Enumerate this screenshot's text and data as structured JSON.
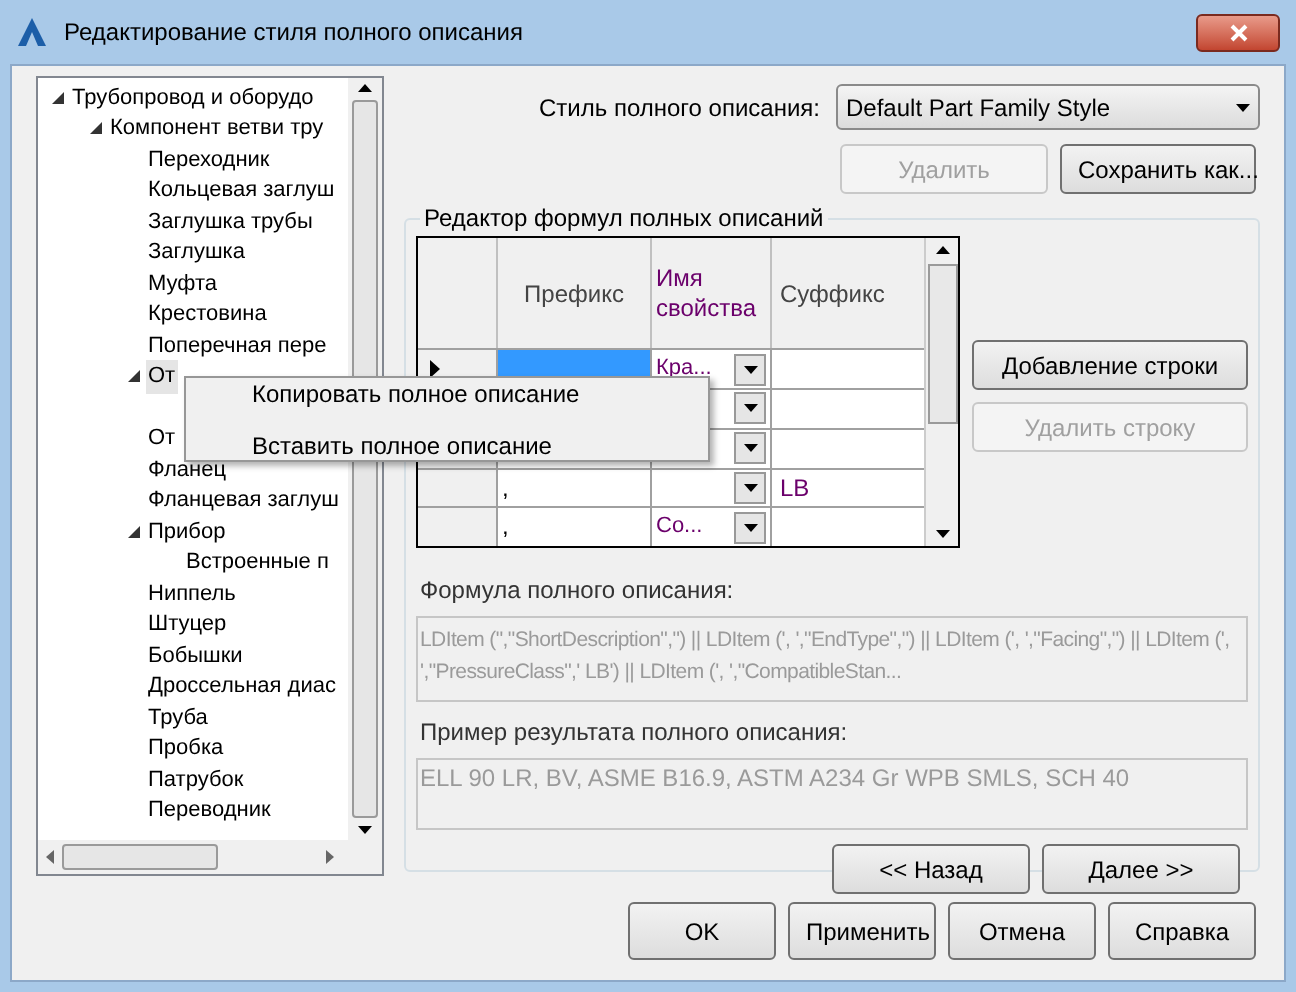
{
  "window": {
    "title": "Редактирование стиля полного описания"
  },
  "tree": [
    {
      "label": "Трубопровод и оборудо",
      "expanded": true,
      "children": [
        {
          "label": "Компонент ветви тру",
          "expanded": true,
          "children": [
            {
              "label": "Переходник"
            },
            {
              "label": "Кольцевая заглуш"
            },
            {
              "label": "Заглушка трубы"
            },
            {
              "label": "Заглушка"
            },
            {
              "label": "Муфта"
            },
            {
              "label": "Крестовина"
            },
            {
              "label": "Поперечная пере"
            },
            {
              "label": "От",
              "expanded": true,
              "selected": true
            },
            {
              "label": "От"
            },
            {
              "label": "Фланец"
            },
            {
              "label": "Фланцевая заглуш"
            },
            {
              "label": "Прибор",
              "expanded": true,
              "children": [
                {
                  "label": "Встроенные п"
                }
              ]
            },
            {
              "label": "Ниппель"
            },
            {
              "label": "Штуцер"
            },
            {
              "label": "Бобышки"
            },
            {
              "label": "Дроссельная диас"
            },
            {
              "label": "Труба"
            },
            {
              "label": "Пробка"
            },
            {
              "label": "Патрубок"
            },
            {
              "label": "Переводник"
            }
          ]
        }
      ]
    }
  ],
  "style": {
    "label": "Стиль полного описания:",
    "value": "Default Part Family Style"
  },
  "style_buttons": [
    {
      "label": "Удалить",
      "disabled": true
    },
    {
      "label": "Сохранить как...",
      "disabled": false
    }
  ],
  "editor": {
    "title": "Редактор формул полных описаний",
    "columns": [
      "Префикс",
      "Имя свойства",
      "Суффикс"
    ],
    "rows": [
      {
        "current": true,
        "prefix_selected": true,
        "property": "Кра..."
      },
      {},
      {},
      {
        "current": false,
        "prefix_selected": false,
        "prefix": ",",
        "suffix": "LB"
      },
      {
        "current": false,
        "prefix_selected": false,
        "prefix": ",",
        "property": "Со..."
      }
    ],
    "row_buttons": [
      {
        "label": "Добавление строки",
        "disabled": false
      },
      {
        "label": "Удалить строку",
        "disabled": true
      }
    ],
    "formula_label": "Формула полного описания:",
    "formula": "LDItem (\",\"ShortDescription\",\") || LDItem (', ',\"EndType\",\") || LDItem (', ',\"Facing\",\") || LDItem (', ',\"PressureClass\",' LB') || LDItem (', ',\"CompatibleStan...",
    "example_label": "Пример результата полного описания:",
    "example": "ELL 90 LR, BV, ASME B16.9, ASTM A234 Gr WPB SMLS, SCH 40",
    "nav_buttons": [
      "<< Назад",
      "Далее >>"
    ]
  },
  "context_menu": [
    "Копировать полное описание",
    "Вставить полное описание"
  ],
  "buttons": [
    "OK",
    "Применить",
    "Отмена",
    "Справка"
  ]
}
